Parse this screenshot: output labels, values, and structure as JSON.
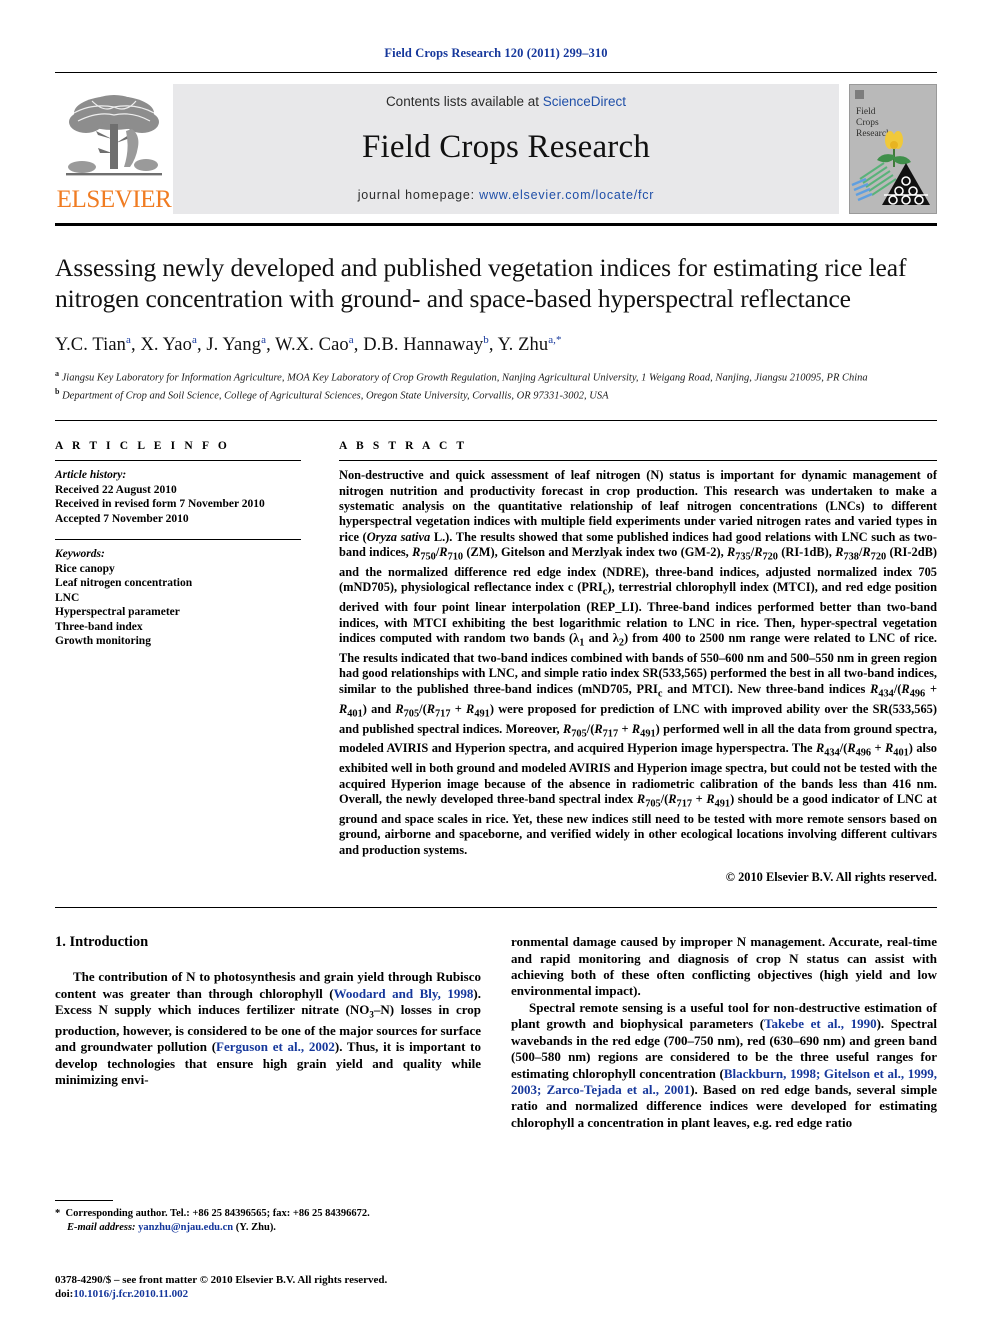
{
  "running_head": "Field Crops Research 120 (2011) 299–310",
  "masthead": {
    "contents_prefix": "Contents lists available at ",
    "sciencedirect": "ScienceDirect",
    "journal_title": "Field Crops Research",
    "homepage_prefix": "journal homepage: ",
    "homepage_url": "www.elsevier.com/locate/fcr",
    "publisher_logo_text": "ELSEVIER",
    "cover_title_lines": [
      "Field",
      "Crops",
      "Research"
    ],
    "accent_orange": "#f07c22",
    "link_blue": "#1f4fa8",
    "band_gray": "#e8e8ea"
  },
  "article": {
    "title": "Assessing newly developed and published vegetation indices for estimating rice leaf nitrogen concentration with ground- and space-based hyperspectral reflectance",
    "authors_html": "Y.C. Tian<sup>a</sup>, X. Yao<sup>a</sup>, J. Yang<sup>a</sup>, W.X. Cao<sup>a</sup>, D.B. Hannaway<sup>b</sup>, Y. Zhu<sup>a,*</sup>",
    "affiliations": [
      "Jiangsu Key Laboratory for Information Agriculture, MOA Key Laboratory of Crop Growth Regulation, Nanjing Agricultural University, 1 Weigang Road, Nanjing, Jiangsu 210095, PR China",
      "Department of Crop and Soil Science, College of Agricultural Sciences, Oregon State University, Corvallis, OR 97331-3002, USA"
    ]
  },
  "article_info": {
    "heading": "A R T I C L E    I N F O",
    "history_label": "Article history:",
    "history": [
      "Received 22 August 2010",
      "Received in revised form 7 November 2010",
      "Accepted 7 November 2010"
    ],
    "keywords_label": "Keywords:",
    "keywords": [
      "Rice canopy",
      "Leaf nitrogen concentration",
      "LNC",
      "Hyperspectral parameter",
      "Three-band index",
      "Growth monitoring"
    ]
  },
  "abstract": {
    "heading": "A B S T R A C T",
    "paragraph_html": "Non-destructive and quick assessment of leaf nitrogen (N) status is important for dynamic management of nitrogen nutrition and productivity forecast in crop production. This research was undertaken to make a systematic analysis on the quantitative relationship of leaf nitrogen concentrations (LNCs) to different hyperspectral vegetation indices with multiple field experiments under varied nitrogen rates and varied types in rice (<i>Oryza sativa</i> L.). The results showed that some published indices had good relations with LNC such as two-band indices, <i>R</i><sub>750</sub>/<i>R</i><sub>710</sub> (ZM), Gitelson and Merzlyak index two (GM-2), <i>R</i><sub>735</sub>/<i>R</i><sub>720</sub> (RI-1dB), <i>R</i><sub>738</sub>/<i>R</i><sub>720</sub> (RI-2dB) and the normalized difference red edge index (NDRE), three-band indices, adjusted normalized index 705 (mND705), physiological reflectance index c (PRI<sub>c</sub>), terrestrial chlorophyll index (MTCI), and red edge position derived with four point linear interpolation (REP_LI). Three-band indices performed better than two-band indices, with MTCI exhibiting the best logarithmic relation to LNC in rice. Then, hyper-spectral vegetation indices computed with random two bands (&#955;<sub>1</sub> and &#955;<sub>2</sub>) from 400 to 2500 nm range were related to LNC of rice. The results indicated that two-band indices combined with bands of 550&#8211;600 nm and 500&#8211;550 nm in green region had good relationships with LNC, and simple ratio index SR(533,565) performed the best in all two-band indices, similar to the published three-band indices (mND705, PRI<sub>c</sub> and MTCI). New three-band indices <i>R</i><sub>434</sub>/(<i>R</i><sub>496</sub> + <i>R</i><sub>401</sub>) and <i>R</i><sub>705</sub>/(<i>R</i><sub>717</sub> + <i>R</i><sub>491</sub>) were proposed for prediction of LNC with improved ability over the SR(533,565) and published spectral indices. Moreover, <i>R</i><sub>705</sub>/(<i>R</i><sub>717</sub> + <i>R</i><sub>491</sub>) performed well in all the data from ground spectra, modeled AVIRIS and Hyperion spectra, and acquired Hyperion image hyperspectra. The <i>R</i><sub>434</sub>/(<i>R</i><sub>496</sub> + <i>R</i><sub>401</sub>) also exhibited well in both ground and modeled AVIRIS and Hyperion image spectra, but could not be tested with the acquired Hyperion image because of the absence in radiometric calibration of the bands less than 416 nm. Overall, the newly developed three-band spectral index <i>R</i><sub>705</sub>/(<i>R</i><sub>717</sub> + <i>R</i><sub>491</sub>) should be a good indicator of LNC at ground and space scales in rice. Yet, these new indices still need to be tested with more remote sensors based on ground, airborne and spaceborne, and verified widely in other ecological locations involving different cultivars and production systems.",
    "copyright": "© 2010 Elsevier B.V. All rights reserved."
  },
  "introduction": {
    "heading": "1.  Introduction",
    "left_paragraph_html": "The contribution of N to photosynthesis and grain yield through Rubisco content was greater than through chlorophyll (<span class=\"cite\">Woodard and Bly, 1998</span>). Excess N supply which induces fertilizer nitrate (NO<sub class=\"sub\">3</sub>&#8211;N) losses in crop production, however, is considered to be one of the major sources for surface and groundwater pollution (<span class=\"cite\">Ferguson et al., 2002</span>). Thus, it is important to develop technologies that ensure high grain yield and quality while minimizing envi-",
    "right_paragraph_1_html": "ronmental damage caused by improper N management. Accurate, real-time and rapid monitoring and diagnosis of crop N status can assist with achieving both of these often conflicting objectives (high yield and low environmental impact).",
    "right_paragraph_2_html": "Spectral remote sensing is a useful tool for non-destructive estimation of plant growth and biophysical parameters (<span class=\"cite\">Takebe et al., 1990</span>). Spectral wavebands in the red edge (700&#8211;750 nm), red (630&#8211;690 nm) and green band (500&#8211;580 nm) regions are considered to be the three useful ranges for estimating chlorophyll concentration (<span class=\"cite\">Blackburn, 1998; Gitelson et al., 1999, 2003; Zarco-Tejada et al., 2001</span>). Based on red edge bands, several simple ratio and normalized difference indices were developed for estimating chlorophyll a concentration in plant leaves, e.g. red edge ratio"
  },
  "footnote": {
    "html": "* &nbsp;Corresponding author. Tel.: +86 25 84396565; fax: +86 25 84396672.<br><span style=\"margin-left:12px\"></span><span class=\"ital\">E-mail address:</span> <span class=\"cite\">yanzhu@njau.edu.cn</span> (Y. Zhu)."
  },
  "colophon": {
    "issn_line": "0378-4290/$ – see front matter © 2010 Elsevier B.V. All rights reserved.",
    "doi_label": "doi:",
    "doi_value": "10.1016/j.fcr.2010.11.002"
  }
}
